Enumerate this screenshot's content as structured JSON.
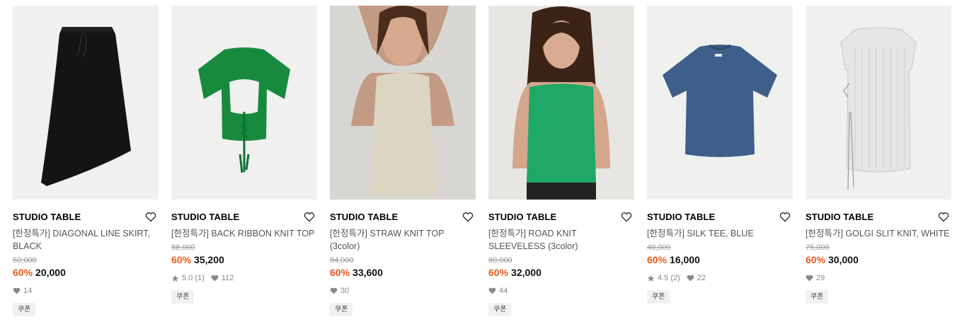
{
  "colors": {
    "discount": "#e85a1c",
    "thumb_bg": "#f0f0ef"
  },
  "products": [
    {
      "brand": "STUDIO TABLE",
      "name": "[한정특가] DIAGONAL LINE SKIRT, BLACK",
      "original_price": "50,000",
      "discount": "60%",
      "price": "20,000",
      "likes": "14",
      "coupon": "쿠폰",
      "image": "black diagonal skirt"
    },
    {
      "brand": "STUDIO TABLE",
      "name": "[한정특가] BACK RIBBON KNIT TOP",
      "original_price": "88,000",
      "discount": "60%",
      "price": "35,200",
      "rating": "5.0 (1)",
      "likes": "112",
      "coupon": "쿠폰",
      "image": "green back ribbon knit top"
    },
    {
      "brand": "STUDIO TABLE",
      "name": "[한정특가] STRAW KNIT TOP (3color)",
      "original_price": "84,000",
      "discount": "60%",
      "price": "33,600",
      "likes": "30",
      "coupon": "쿠폰",
      "image": "model in beige straw knit top"
    },
    {
      "brand": "STUDIO TABLE",
      "name": "[한정특가] ROAD KNIT SLEEVELESS (3color)",
      "original_price": "80,000",
      "discount": "60%",
      "price": "32,000",
      "likes": "44",
      "coupon": "쿠폰",
      "image": "model in green crochet sleeveless"
    },
    {
      "brand": "STUDIO TABLE",
      "name": "[한정특가] SILK TEE, BLUE",
      "original_price": "40,000",
      "discount": "60%",
      "price": "16,000",
      "rating": "4.5 (2)",
      "likes": "22",
      "coupon": "쿠폰",
      "image": "blue silk tee"
    },
    {
      "brand": "STUDIO TABLE",
      "name": "[한정특가] GOLGI SLIT KNIT, WHITE",
      "original_price": "75,000",
      "discount": "60%",
      "price": "30,000",
      "likes": "29",
      "coupon": "쿠폰",
      "image": "white ribbed slit knit"
    }
  ]
}
